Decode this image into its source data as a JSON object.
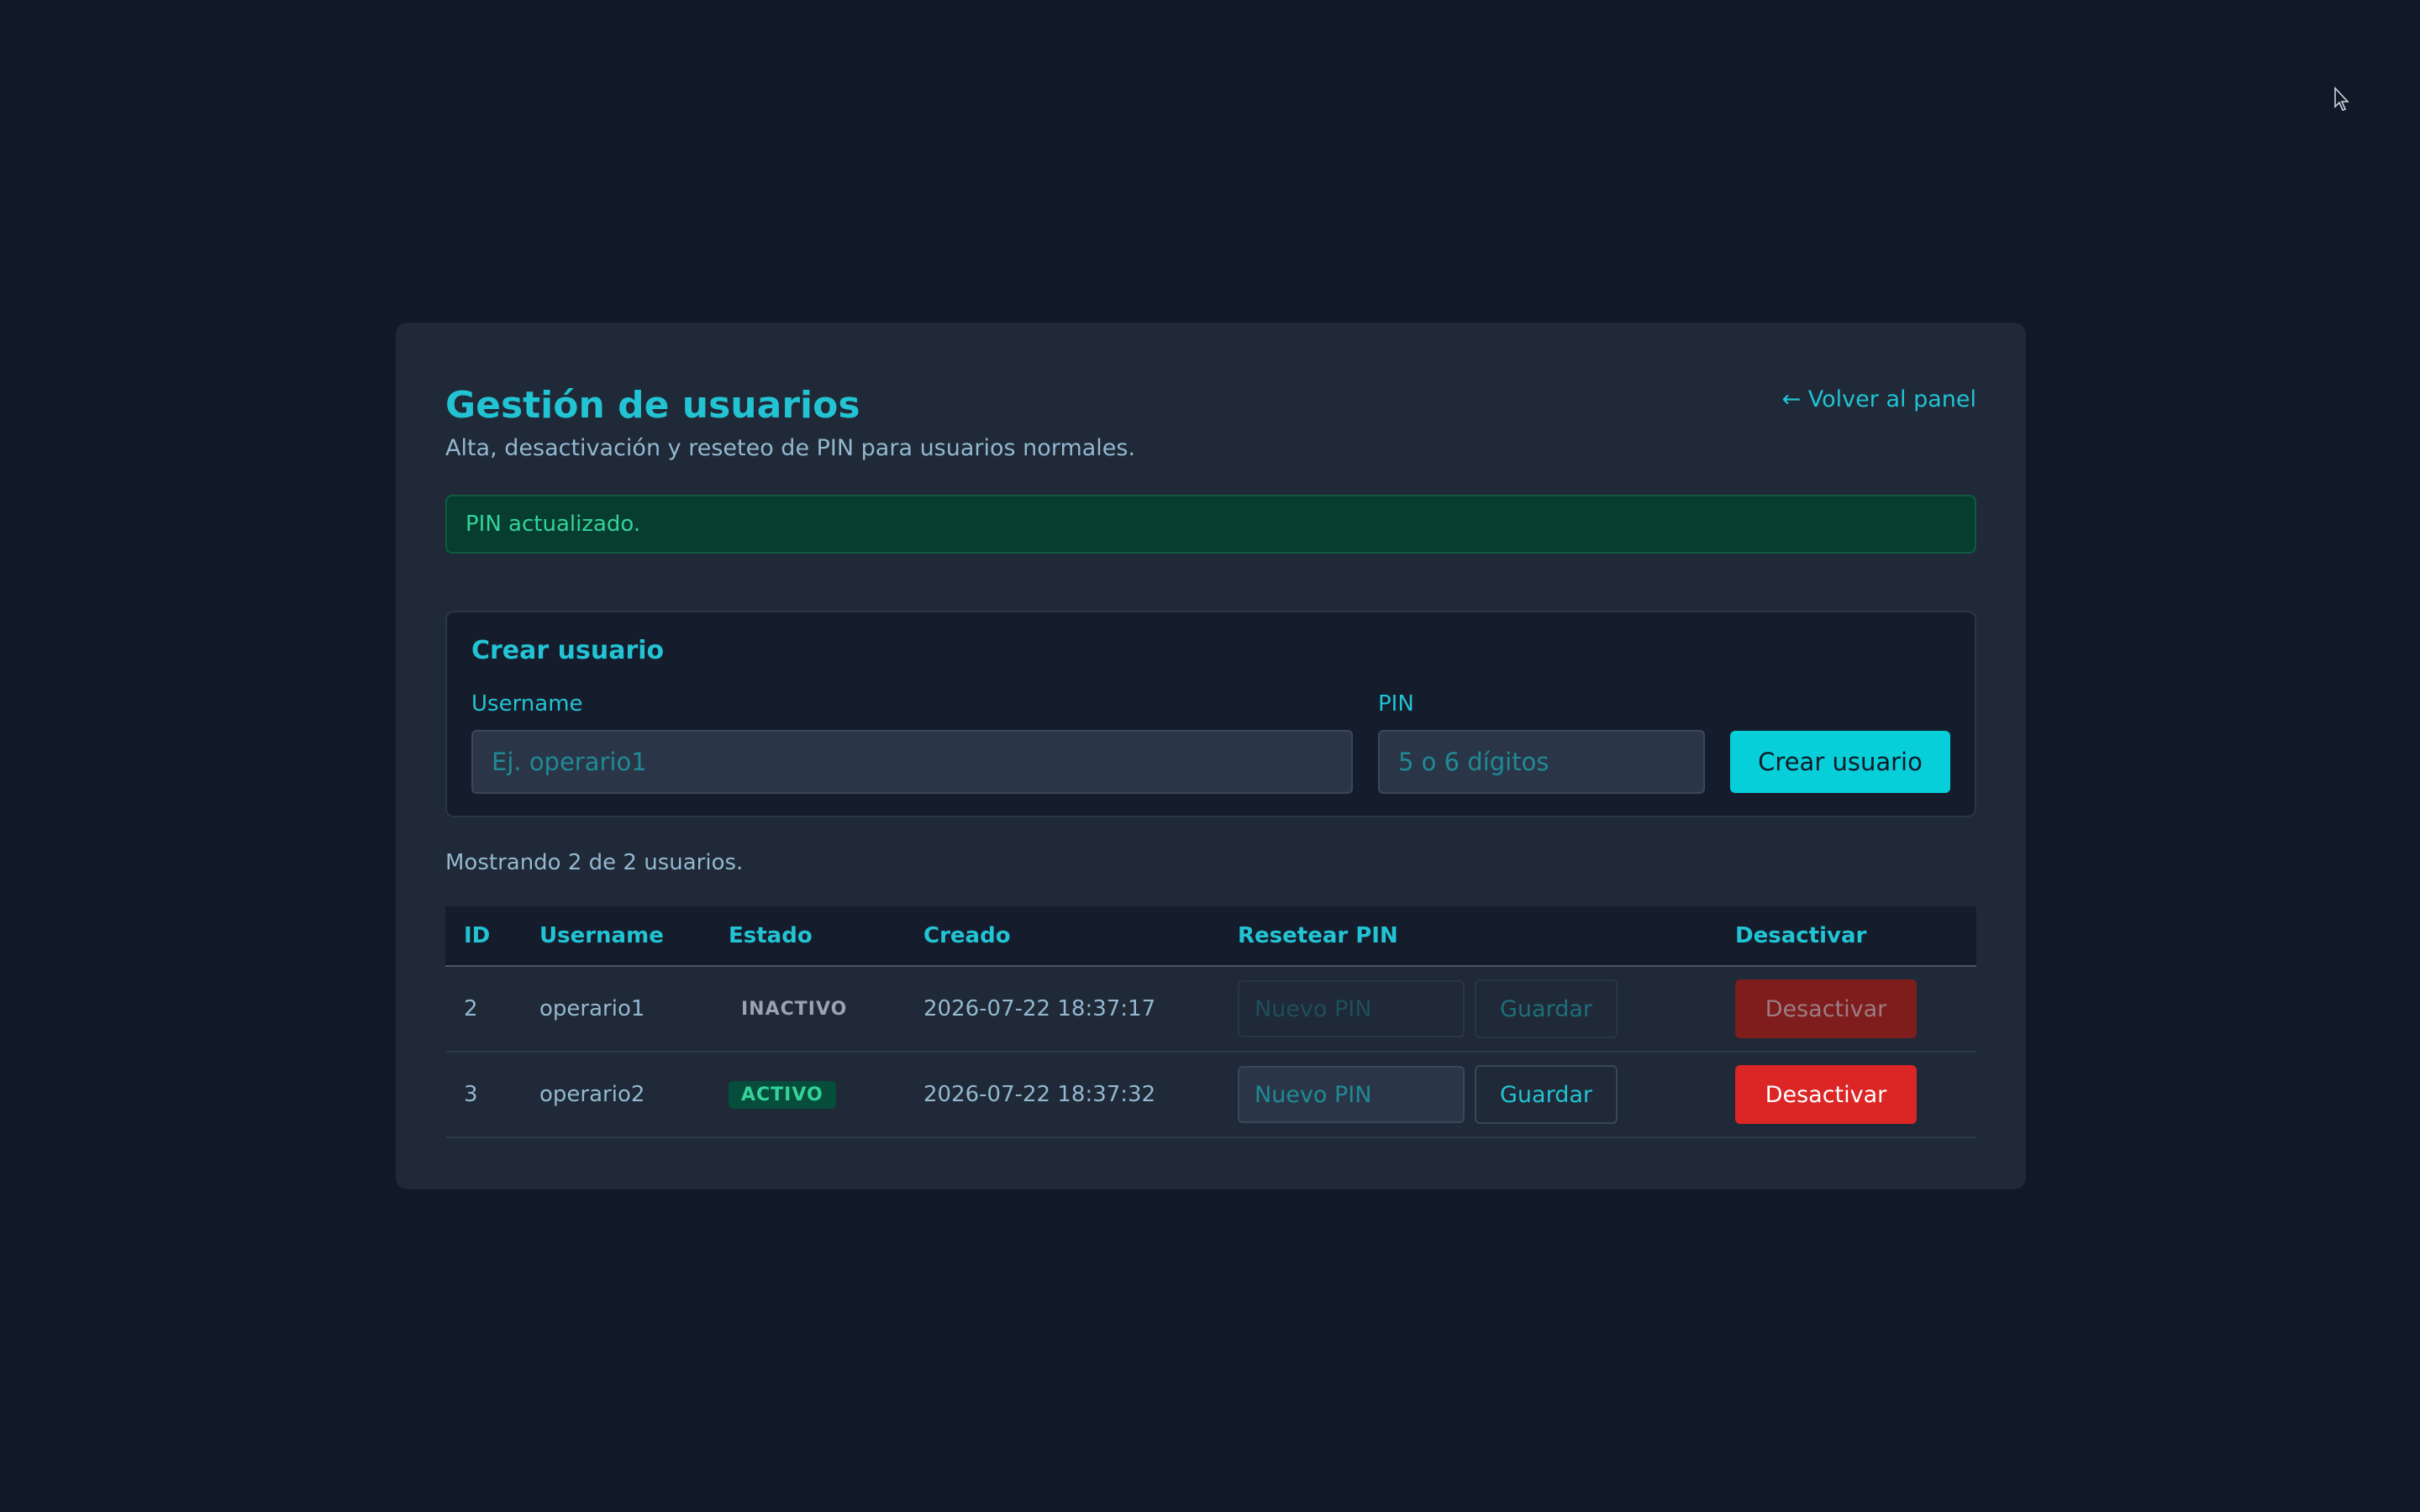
{
  "header": {
    "title": "Gestión de usuarios",
    "subtitle": "Alta, desactivación y reseteo de PIN para usuarios normales.",
    "back_link": "← Volver al panel"
  },
  "alert": {
    "text": "PIN actualizado.",
    "color": "#34d399"
  },
  "create_form": {
    "title": "Crear usuario",
    "username_label": "Username",
    "username_placeholder": "Ej. operario1",
    "username_value": "",
    "pin_label": "PIN",
    "pin_placeholder": "5 o 6 dígitos",
    "pin_value": "",
    "submit_label": "Crear usuario"
  },
  "summary": "Mostrando 2 de 2 usuarios.",
  "table": {
    "columns": [
      "ID",
      "Username",
      "Estado",
      "Creado",
      "Resetear PIN",
      "Desactivar"
    ],
    "rows": [
      {
        "id": "2",
        "username": "operario1",
        "status": "INACTIVO",
        "created": "2026-07-22 18:37:17",
        "pin_placeholder": "Nuevo PIN",
        "save_label": "Guardar",
        "deactivate_label": "Desactivar",
        "enabled": false
      },
      {
        "id": "3",
        "username": "operario2",
        "status": "ACTIVO",
        "created": "2026-07-22 18:37:32",
        "pin_placeholder": "Nuevo PIN",
        "save_label": "Guardar",
        "deactivate_label": "Desactivar",
        "enabled": true
      }
    ]
  },
  "colors": {
    "background": "#111827",
    "card": "#1f2937",
    "accent": "#22c3d3",
    "primary_button": "#06cfd9",
    "danger": "#dc2626",
    "success": "#34d399"
  }
}
